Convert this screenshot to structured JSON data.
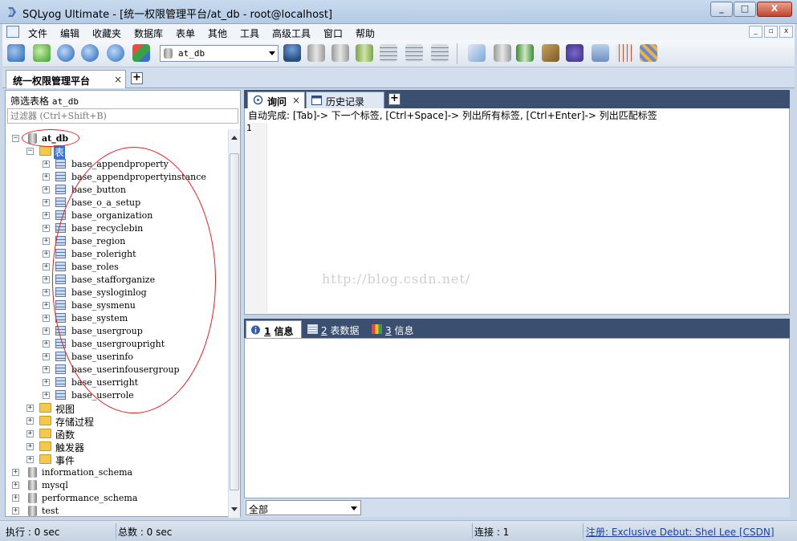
{
  "window": {
    "title": "SQLyog Ultimate - [统一权限管理平台/at_db - root@localhost]",
    "controls": [
      "_",
      "□",
      "X"
    ]
  },
  "menu": {
    "items": [
      "文件",
      "编辑",
      "收藏夹",
      "数据库",
      "表单",
      "其他",
      "工具",
      "高级工具",
      "窗口",
      "帮助"
    ],
    "mdi_controls": [
      "_",
      "▫",
      "x"
    ]
  },
  "toolbar": {
    "database_selector": "at_db"
  },
  "connection_tab": {
    "label": "统一权限管理平台",
    "close": "×",
    "add": "+"
  },
  "object_browser": {
    "filter_label_prefix": "筛选表格",
    "filter_label_db": "at_db",
    "filter_placeholder": "过滤器 (Ctrl+Shift+B)",
    "active_db": "at_db",
    "tables_folder": "表",
    "tables": [
      "base_appendproperty",
      "base_appendpropertyinstance",
      "base_button",
      "base_o_a_setup",
      "base_organization",
      "base_recyclebin",
      "base_region",
      "base_roleright",
      "base_roles",
      "base_stafforganize",
      "base_sysloginlog",
      "base_sysmenu",
      "base_system",
      "base_usergroup",
      "base_usergroupright",
      "base_userinfo",
      "base_userinfousergroup",
      "base_userright",
      "base_userrole"
    ],
    "other_folders": [
      "视图",
      "存储过程",
      "函数",
      "触发器",
      "事件"
    ],
    "other_databases": [
      "information_schema",
      "mysql",
      "performance_schema",
      "test"
    ]
  },
  "query_tabs": {
    "query": "询问",
    "query_close": "×",
    "history": "历史记录",
    "add": "+"
  },
  "editor": {
    "autocomplete_hint": "自动完成: [Tab]-> 下一个标签, [Ctrl+Space]-> 列出所有标签, [Ctrl+Enter]-> 列出匹配标签",
    "line_number": "1",
    "watermark": "http://blog.csdn.net/"
  },
  "result_tabs": [
    {
      "num": "1",
      "label": "信息"
    },
    {
      "num": "2",
      "label": "表数据"
    },
    {
      "num": "3",
      "label": "信息"
    }
  ],
  "result_filter": "全部",
  "status": {
    "exec": "执行 : 0 sec",
    "total": "总数 : 0 sec",
    "connections": "连接 : 1",
    "registration": "注册:  Exclusive Debut: Shel Lee [CSDN]"
  }
}
